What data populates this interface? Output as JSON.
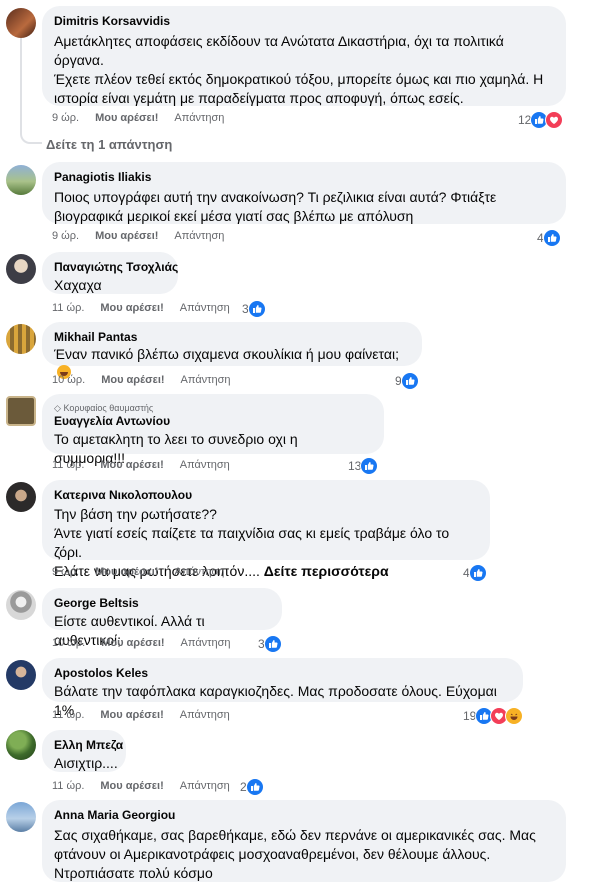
{
  "comments": [
    {
      "name": "Dimitris Korsavvidis",
      "text": "Αμετάκλητες αποφάσεις εκδίδουν τα Ανώτατα Δικαστήρια, όχι τα πολιτικά όργανα.\nΈχετε πλέον τεθεί εκτός δημοκρατικού τόξου, μπορείτε όμως και πιο χαμηλά. Η ιστορία είναι γεμάτη με παραδείγματα προς αποφυγή, όπως εσείς.",
      "time": "9 ώρ.",
      "like": "Μου αρέσει!",
      "reply": "Απάντηση",
      "count": "12",
      "reactions": [
        "like",
        "love"
      ]
    },
    {
      "name": "Panagiotis Iliakis",
      "text": "Ποιος υπογράφει αυτή την ανακοίνωση? Τι ρεζιλικια είναι αυτά? Φτιάξτε βιογραφικά μερικοί εκεί μέσα γιατί σας βλέπω με απόλυση",
      "time": "9 ώρ.",
      "like": "Μου αρέσει!",
      "reply": "Απάντηση",
      "count": "4",
      "reactions": [
        "like"
      ]
    },
    {
      "name": "Παναγιώτης Τσοχλιάς",
      "text": "Χαχαχα",
      "time": "11 ώρ.",
      "like": "Μου αρέσει!",
      "reply": "Απάντηση",
      "count": "3",
      "reactions": [
        "like"
      ]
    },
    {
      "name": "Mikhail Pantas",
      "text": "Έναν πανικό βλέπω σιχαμενα σκουλίκια ή μου φαίνεται;",
      "time": "10 ώρ.",
      "like": "Μου αρέσει!",
      "reply": "Απάντηση",
      "count": "9",
      "reactions": [
        "like"
      ]
    },
    {
      "badge": "Κορυφαίος θαυμαστής",
      "name": "Ευαγγελία Αντωνίου",
      "text": "Το αμετακλητη το λεει το συνεδριο οχι η συμμορια!!!",
      "time": "11 ώρ.",
      "like": "Μου αρέσει!",
      "reply": "Απάντηση",
      "count": "13",
      "reactions": [
        "like"
      ]
    },
    {
      "name": "Κατερινα Νικολοπουλου",
      "text": "Την βάση την ρωτήσατε??\nΆντε γιατί εσείς παίζετε τα παιχνίδια σας κι εμείς τραβάμε όλο το ζόρι.\nΕλάτε να μας ρωτήσετε λοιπόν....",
      "more": "Δείτε περισσότερα",
      "time": "9 ώρ.",
      "like": "Μου αρέσει!",
      "reply": "Απάντηση",
      "count": "4",
      "reactions": [
        "like"
      ]
    },
    {
      "name": "George Beltsis",
      "text": "Είστε αυθεντικοί. Αλλά τι αυθεντικοί;",
      "time": "10 ώρ.",
      "like": "Μου αρέσει!",
      "reply": "Απάντηση",
      "count": "3",
      "reactions": [
        "like"
      ]
    },
    {
      "name": "Apostolos Keles",
      "text": "Βάλατε την ταφόπλακα καραγκιοζηδες. Μας προδοσατε όλους. Εύχομαι 1%",
      "time": "11 ώρ.",
      "like": "Μου αρέσει!",
      "reply": "Απάντηση",
      "count": "19",
      "reactions": [
        "like",
        "love",
        "haha"
      ]
    },
    {
      "name": "Ελλη Μπεζα",
      "text": "Αισιχτιρ....",
      "time": "11 ώρ.",
      "like": "Μου αρέσει!",
      "reply": "Απάντηση",
      "count": "2",
      "reactions": [
        "like"
      ]
    },
    {
      "name": "Anna Maria Georgiou",
      "text": "Σας σιχαθήκαμε, σας βαρεθήκαμε, εδώ δεν περνάνε οι αμερικανικές σας. Μας φτάνουν οι Αμερικανοτράφεις μοσχοαναθρεμένοι, δεν θέλουμε άλλους. Ντροπιάσατε πολύ κόσμο"
    }
  ],
  "see_replies": "Δείτε τη 1 απάντηση",
  "colors": {
    "like": "#1877f2",
    "love": "#f33e58",
    "haha": "#f7b125",
    "bubble": "#f0f2f5",
    "meta": "#65676b"
  }
}
